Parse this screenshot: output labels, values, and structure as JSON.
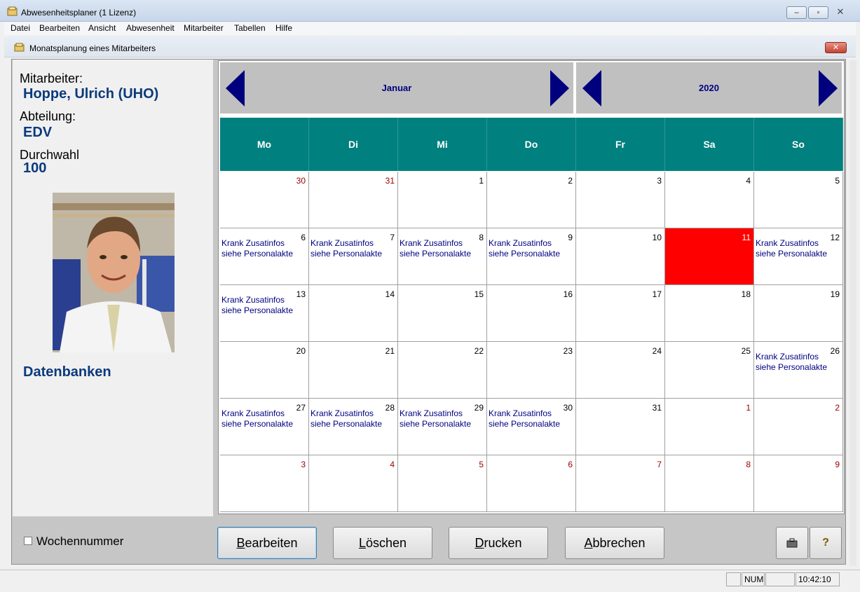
{
  "window": {
    "title": "Abwesenheitsplaner  (1 Lizenz)",
    "controls": {
      "minimize": "‒",
      "maximize": "▫",
      "close": "✕"
    }
  },
  "menu": [
    "Datei",
    "Bearbeiten",
    "Ansicht",
    "Abwesenheit",
    "Mitarbeiter",
    "Tabellen",
    "Hilfe"
  ],
  "child": {
    "title": "Monatsplanung eines Mitarbeiters",
    "close": "✕"
  },
  "employee": {
    "name_label": "Mitarbeiter:",
    "name": "Hoppe, Ulrich  (UHO)",
    "dept_label": "Abteilung:",
    "dept": "EDV",
    "ext_label": "Durchwahl",
    "ext": "100",
    "group": "Datenbanken"
  },
  "calendar": {
    "month": "Januar",
    "year": "2020",
    "weekdays": [
      "Mo",
      "Di",
      "Mi",
      "Do",
      "Fr",
      "Sa",
      "So"
    ],
    "note_text": "Krank Zusatinfos siehe Personalakte",
    "weeks": [
      [
        {
          "d": "30",
          "cur": false
        },
        {
          "d": "31",
          "cur": false
        },
        {
          "d": "1",
          "cur": true
        },
        {
          "d": "2",
          "cur": true
        },
        {
          "d": "3",
          "cur": true
        },
        {
          "d": "4",
          "cur": true
        },
        {
          "d": "5",
          "cur": true
        }
      ],
      [
        {
          "d": "6",
          "cur": true,
          "note": true
        },
        {
          "d": "7",
          "cur": true,
          "note": true
        },
        {
          "d": "8",
          "cur": true,
          "note": true
        },
        {
          "d": "9",
          "cur": true,
          "note": true
        },
        {
          "d": "10",
          "cur": true
        },
        {
          "d": "11",
          "cur": true,
          "today": true
        },
        {
          "d": "12",
          "cur": true,
          "note": true
        }
      ],
      [
        {
          "d": "13",
          "cur": true,
          "note": true
        },
        {
          "d": "14",
          "cur": true
        },
        {
          "d": "15",
          "cur": true
        },
        {
          "d": "16",
          "cur": true
        },
        {
          "d": "17",
          "cur": true
        },
        {
          "d": "18",
          "cur": true
        },
        {
          "d": "19",
          "cur": true
        }
      ],
      [
        {
          "d": "20",
          "cur": true
        },
        {
          "d": "21",
          "cur": true
        },
        {
          "d": "22",
          "cur": true
        },
        {
          "d": "23",
          "cur": true
        },
        {
          "d": "24",
          "cur": true
        },
        {
          "d": "25",
          "cur": true
        },
        {
          "d": "26",
          "cur": true,
          "note": true
        }
      ],
      [
        {
          "d": "27",
          "cur": true,
          "note": true
        },
        {
          "d": "28",
          "cur": true,
          "note": true
        },
        {
          "d": "29",
          "cur": true,
          "note": true
        },
        {
          "d": "30",
          "cur": true,
          "note": true
        },
        {
          "d": "31",
          "cur": true
        },
        {
          "d": "1",
          "cur": false
        },
        {
          "d": "2",
          "cur": false
        }
      ],
      [
        {
          "d": "3",
          "cur": false
        },
        {
          "d": "4",
          "cur": false
        },
        {
          "d": "5",
          "cur": false
        },
        {
          "d": "6",
          "cur": false
        },
        {
          "d": "7",
          "cur": false
        },
        {
          "d": "8",
          "cur": false
        },
        {
          "d": "9",
          "cur": false
        }
      ]
    ],
    "colors": {
      "header": "#00807f",
      "today": "#ff0000",
      "nav_arrow": "#00007f",
      "note": "#000080"
    }
  },
  "footer": {
    "week_number_label": "Wochennummer",
    "buttons": {
      "edit": {
        "hot": "B",
        "rest": "earbeiten"
      },
      "delete": {
        "hot": "L",
        "rest": "öschen"
      },
      "print": {
        "hot": "D",
        "rest": "rucken"
      },
      "cancel": {
        "hot": "A",
        "rest": "bbrechen"
      }
    },
    "icon_buttons": {
      "tool": "briefcase-icon",
      "help": "?"
    }
  },
  "status": {
    "num": "NUM",
    "time": "10:42:10"
  }
}
